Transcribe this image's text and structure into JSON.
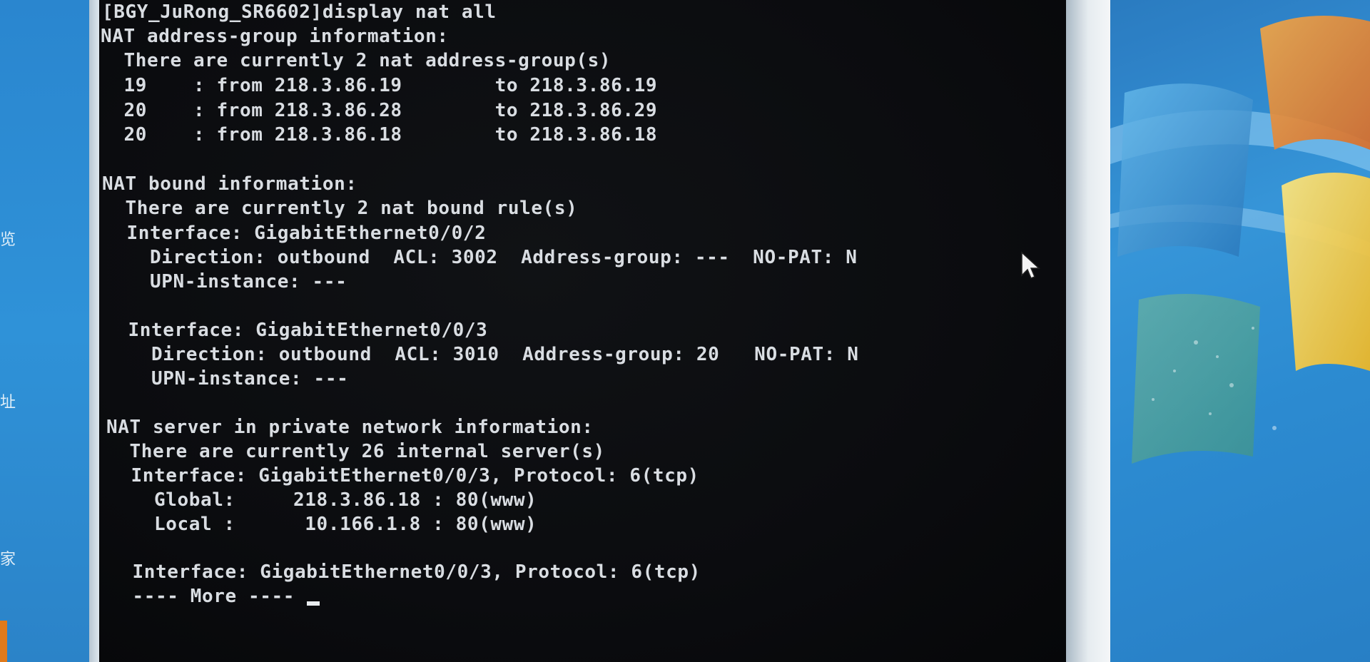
{
  "terminal": {
    "lines": [
      "[BGY_JuRong_SR6602]display nat all",
      "NAT address-group information:",
      "  There are currently 2 nat address-group(s)",
      "  19    : from 218.3.86.19        to 218.3.86.19",
      "  20    : from 218.3.86.28        to 218.3.86.29",
      "  20    : from 218.3.86.18        to 218.3.86.18",
      "NAT bound information:",
      "  There are currently 2 nat bound rule(s)",
      "  Interface: GigabitEthernet0/0/2",
      "    Direction: outbound  ACL: 3002  Address-group: ---  NO-PAT: N",
      "    UPN-instance: ---",
      "  Interface: GigabitEthernet0/0/3",
      "    Direction: outbound  ACL: 3010  Address-group: 20   NO-PAT: N",
      "    UPN-instance: ---",
      "NAT server in private network information:",
      "  There are currently 26 internal server(s)",
      "  Interface: GigabitEthernet0/0/3, Protocol: 6(tcp)",
      "    Global:     218.3.86.18 : 80(www)",
      "    Local :      10.166.1.8 : 80(www)",
      "  Interface: GigabitEthernet0/0/3, Protocol: 6(tcp)",
      "  ---- More ----"
    ]
  },
  "desktop": {
    "left_glyphs": [
      "览",
      "址",
      "家"
    ]
  },
  "colors": {
    "terminal_bg": "#0b0c0f",
    "terminal_text": "#d9dde2",
    "desktop_blue": "#1f84cf",
    "flag_yellow": "#f2d33a"
  },
  "icons": {
    "mouse_pointer": "arrow-cursor-icon"
  }
}
